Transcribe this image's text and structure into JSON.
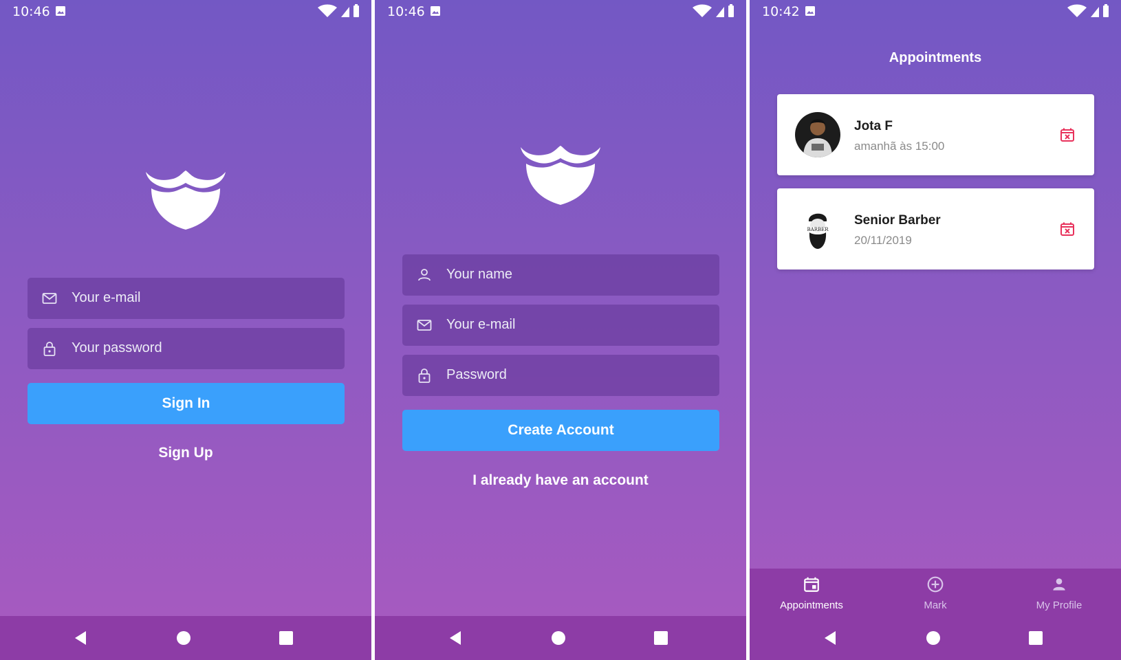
{
  "screens": {
    "signin": {
      "status": {
        "time": "10:46"
      },
      "email_placeholder": "Your e-mail",
      "password_placeholder": "Your password",
      "sign_in_label": "Sign In",
      "sign_up_label": "Sign Up"
    },
    "signup": {
      "status": {
        "time": "10:46"
      },
      "name_placeholder": "Your name",
      "email_placeholder": "Your e-mail",
      "password_placeholder": "Password",
      "create_label": "Create Account",
      "have_account_label": "I already have an account"
    },
    "appointments": {
      "status": {
        "time": "10:42"
      },
      "title": "Appointments",
      "items": [
        {
          "name": "Jota F",
          "when": "amanhã às 15:00",
          "avatar": "person-photo"
        },
        {
          "name": "Senior Barber",
          "when": "20/11/2019",
          "avatar": "bearded-barber-logo"
        }
      ],
      "avatar_logo_text": "BARBER",
      "tabs": [
        {
          "label": "Appointments",
          "icon": "calendar-icon",
          "active": true
        },
        {
          "label": "Mark",
          "icon": "add-circle-icon",
          "active": false
        },
        {
          "label": "My Profile",
          "icon": "person-icon",
          "active": false
        }
      ]
    }
  },
  "colors": {
    "gradient_top": "#7358c4",
    "gradient_bottom": "#a95ac0",
    "primary_button": "#3aa0fc",
    "nav_bar": "#8d3ca6",
    "cancel_icon": "#e8315b"
  }
}
